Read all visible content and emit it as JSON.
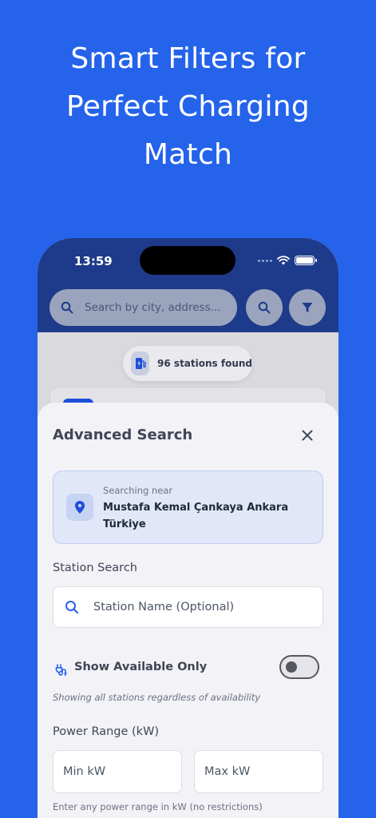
{
  "headline": {
    "line1": "Smart Filters for",
    "line2": "Perfect Charging",
    "line3": "Match"
  },
  "status_bar": {
    "time": "13:59"
  },
  "search": {
    "placeholder": "Search by city, address..."
  },
  "results": {
    "count_label": "96 stations found"
  },
  "sheet": {
    "title": "Advanced Search",
    "location": {
      "label": "Searching near",
      "address": "Mustafa Kemal Çankaya Ankara Türkiye"
    },
    "station_search": {
      "label": "Station Search",
      "placeholder": "Station Name (Optional)"
    },
    "availability": {
      "label": "Show Available Only",
      "enabled": false,
      "hint": "Showing all stations regardless of availability"
    },
    "power_range": {
      "label": "Power Range (kW)",
      "min_placeholder": "Min kW",
      "max_placeholder": "Max kW",
      "hint": "Enter any power range in kW (no restrictions)"
    }
  },
  "colors": {
    "background": "#2563eb",
    "header": "#1e3a8a",
    "accent": "#2563eb"
  }
}
